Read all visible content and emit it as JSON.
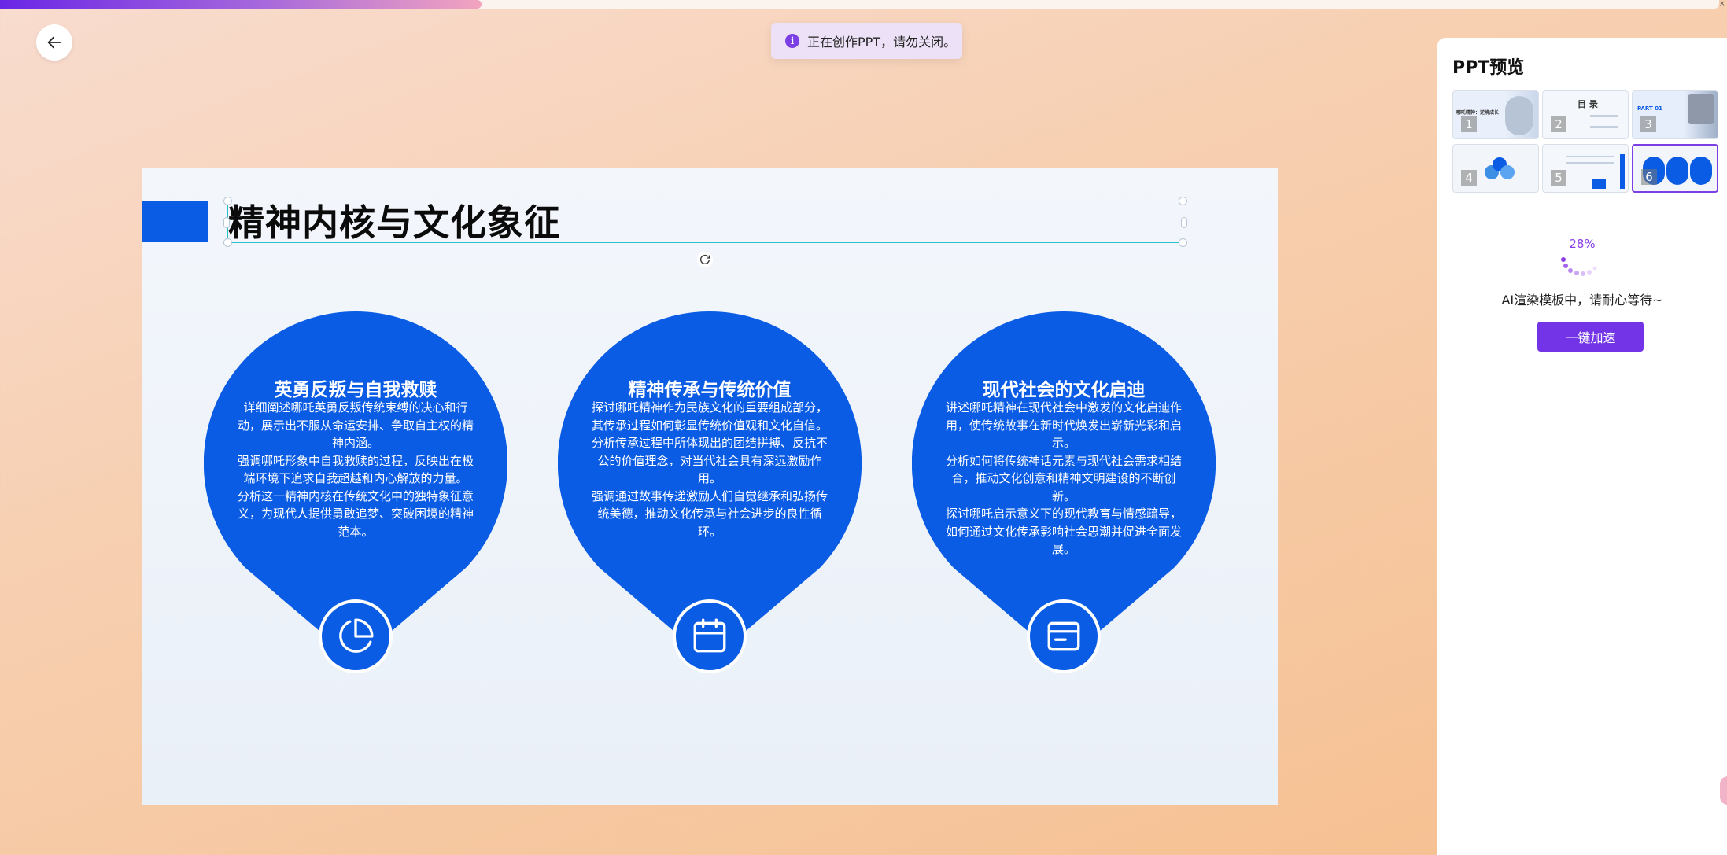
{
  "progress": {
    "fraction": 0.28,
    "fill_color": "#6a26e6"
  },
  "toast": {
    "icon": "info-icon",
    "text": "正在创作PPT，请勿关闭。"
  },
  "slide": {
    "title": "精神内核与文化象征",
    "accent_color": "#0a5ce4",
    "cards": [
      {
        "title": "英勇反叛与自我救赎",
        "paragraphs": [
          "详细阐述哪吒英勇反叛传统束缚的决心和行动，展示出不服从命运安排、争取自主权的精神内涵。",
          "强调哪吒形象中自我救赎的过程，反映出在极端环境下追求自我超越和内心解放的力量。",
          "分析这一精神内核在传统文化中的独特象征意义，为现代人提供勇敢追梦、突破困境的精神范本。"
        ],
        "icon": "pie-chart-icon"
      },
      {
        "title": "精神传承与传统价值",
        "paragraphs": [
          "探讨哪吒精神作为民族文化的重要组成部分，其传承过程如何彰显传统价值观和文化自信。",
          "分析传承过程中所体现出的团结拼搏、反抗不公的价值理念，对当代社会具有深远激励作用。",
          "强调通过故事传递激励人们自觉继承和弘扬传统美德，推动文化传承与社会进步的良性循环。"
        ],
        "icon": "calendar-icon"
      },
      {
        "title": "现代社会的文化启迪",
        "paragraphs": [
          "讲述哪吒精神在现代社会中激发的文化启迪作用，使传统故事在新时代焕发出崭新光彩和启示。",
          "分析如何将传统神话元素与现代社会需求相结合，推动文化创意和精神文明建设的不断创新。",
          "探讨哪吒启示意义下的现代教育与情感疏导，如何通过文化传承影响社会思潮并促进全面发展。"
        ],
        "icon": "card-icon"
      }
    ]
  },
  "panel": {
    "title": "PPT预览",
    "thumbnails": [
      {
        "num": "1",
        "caption": "哪吒精神：逆境成长",
        "active": false
      },
      {
        "num": "2",
        "caption": "目 录",
        "active": false
      },
      {
        "num": "3",
        "caption": "PART 01",
        "active": false
      },
      {
        "num": "4",
        "caption": "",
        "active": false
      },
      {
        "num": "5",
        "caption": "",
        "active": false
      },
      {
        "num": "6",
        "caption": "",
        "active": true
      }
    ],
    "percent": "28%",
    "wait_text": "AI渲染模板中，请耐心等待~",
    "speed_button": "一键加速",
    "accent_color": "#7234e6"
  }
}
